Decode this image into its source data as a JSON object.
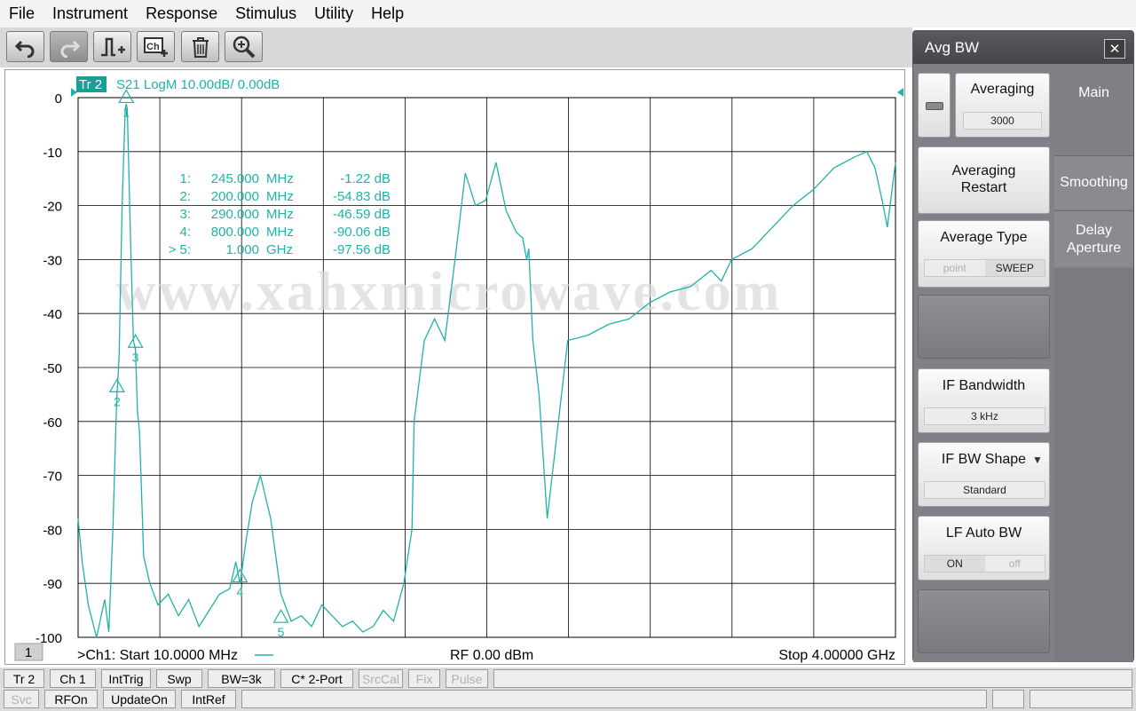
{
  "menu": [
    "File",
    "Instrument",
    "Response",
    "Stimulus",
    "Utility",
    "Help"
  ],
  "toolbar": {
    "buttons": [
      {
        "name": "undo-button",
        "icon": "undo-icon"
      },
      {
        "name": "redo-button",
        "icon": "redo-icon"
      },
      {
        "name": "add-marker-button",
        "icon": "marker-add-icon"
      },
      {
        "name": "add-channel-button",
        "icon": "channel-add-icon",
        "text": "Ch"
      },
      {
        "name": "delete-button",
        "icon": "trash-icon"
      },
      {
        "name": "zoom-button",
        "icon": "zoom-in-icon"
      }
    ]
  },
  "trace": {
    "badge": "Tr 2",
    "header": "S21 LogM 10.00dB/  0.00dB",
    "color": "#20b2aa"
  },
  "markers": [
    {
      "id": "1:",
      "freq": "245.000",
      "unit": "MHz",
      "value": "-1.22 dB"
    },
    {
      "id": "2:",
      "freq": "200.000",
      "unit": "MHz",
      "value": "-54.83 dB"
    },
    {
      "id": "3:",
      "freq": "290.000",
      "unit": "MHz",
      "value": "-46.59 dB"
    },
    {
      "id": "4:",
      "freq": "800.000",
      "unit": "MHz",
      "value": "-90.06 dB"
    },
    {
      "id": "> 5:",
      "freq": "1.000",
      "unit": "GHz",
      "value": "-97.56 dB"
    }
  ],
  "watermark": "www.xahxmicrowave.com",
  "channel_number": "1",
  "footer": {
    "start": ">Ch1:  Start  10.0000 MHz",
    "power": "RF    0.00 dBm",
    "stop": "Stop  4.00000 GHz"
  },
  "chart_data": {
    "type": "line",
    "ylim": [
      -100,
      0
    ],
    "yticks": [
      "0",
      "-10",
      "-20",
      "-30",
      "-40",
      "-50",
      "-60",
      "-70",
      "-80",
      "-90",
      "-100"
    ],
    "xlim": [
      10,
      4000
    ],
    "x_unit": "MHz",
    "grid": true,
    "series": [
      {
        "x": [
          10,
          30,
          60,
          100,
          140,
          160,
          180,
          195,
          200,
          210,
          225,
          240,
          245,
          250,
          265,
          280,
          290,
          300,
          310,
          330,
          360,
          400,
          450,
          500,
          550,
          600,
          650,
          700,
          750,
          780,
          800,
          830,
          860,
          900,
          950,
          1000,
          1050,
          1100,
          1150,
          1200,
          1250,
          1300,
          1350,
          1400,
          1450,
          1500,
          1550,
          1600,
          1640,
          1650,
          1700,
          1750,
          1800,
          1850,
          1900,
          1950,
          2000,
          2050,
          2100,
          2150,
          2180,
          2200,
          2210,
          2230,
          2260,
          2300,
          2400,
          2500,
          2600,
          2700,
          2800,
          2900,
          3000,
          3100,
          3150,
          3200,
          3300,
          3400,
          3500,
          3600,
          3700,
          3800,
          3860,
          3900,
          3940,
          3960,
          3980,
          4000
        ],
        "y": [
          -78,
          -86,
          -94,
          -100,
          -93,
          -99,
          -80,
          -60,
          -54.8,
          -48,
          -20,
          -2,
          -1.2,
          -2,
          -25,
          -45,
          -46.6,
          -58,
          -62,
          -85,
          -90,
          -94,
          -92,
          -96,
          -93,
          -98,
          -95,
          -92,
          -91,
          -86,
          -90.1,
          -82,
          -75,
          -70,
          -78,
          -92,
          -97,
          -96,
          -98,
          -94,
          -96,
          -98,
          -97,
          -99,
          -98,
          -95,
          -97,
          -90,
          -80,
          -60,
          -45,
          -41,
          -45,
          -30,
          -14,
          -20,
          -19,
          -12,
          -21,
          -25,
          -26,
          -30,
          -28,
          -45,
          -55,
          -78,
          -45,
          -44,
          -42,
          -41,
          -38,
          -36,
          -35,
          -32,
          -34,
          -30,
          -28,
          -24,
          -20,
          -17,
          -13,
          -11,
          -10,
          -13,
          -20,
          -24,
          -18,
          -12
        ]
      }
    ],
    "marker_points": [
      {
        "label": "1",
        "x": 245,
        "y": -1.22
      },
      {
        "label": "2",
        "x": 200,
        "y": -54.83
      },
      {
        "label": "3",
        "x": 290,
        "y": -46.59
      },
      {
        "label": "4",
        "x": 800,
        "y": -90.06
      },
      {
        "label": "5",
        "x": 1000,
        "y": -97.56
      }
    ]
  },
  "statusbar": {
    "row1": [
      "Tr 2",
      "Ch 1",
      "IntTrig",
      "Swp",
      "BW=3k",
      "C* 2-Port",
      "SrcCal",
      "Fix",
      "Pulse"
    ],
    "row2": [
      "Svc",
      "RFOn",
      "UpdateOn",
      "IntRef"
    ]
  },
  "softkey_panel": {
    "title": "Avg BW",
    "averaging_label": "Averaging",
    "averaging_value": "3000",
    "restart_line1": "Averaging",
    "restart_line2": "Restart",
    "avg_type_label": "Average Type",
    "avg_type_opt1": "point",
    "avg_type_opt2": "SWEEP",
    "if_bw_label": "IF Bandwidth",
    "if_bw_value": "3 kHz",
    "if_shape_label": "IF BW Shape",
    "if_shape_value": "Standard",
    "lf_auto_label": "LF Auto BW",
    "lf_opt_on": "ON",
    "lf_opt_off": "off",
    "tabs": [
      "Main",
      "Smoothing",
      "Delay\nAperture"
    ]
  }
}
